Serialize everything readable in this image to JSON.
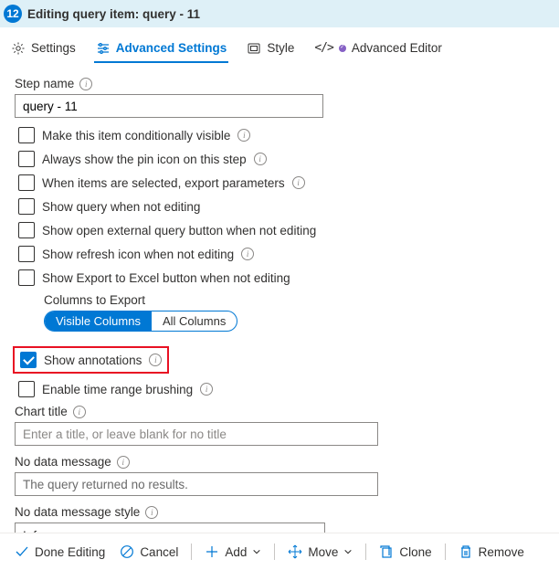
{
  "header": {
    "stepNumber": "12",
    "title": "Editing query item: query - 11"
  },
  "tabs": {
    "settings": "Settings",
    "advanced": "Advanced Settings",
    "style": "Style",
    "advancedEditor": "Advanced Editor"
  },
  "fields": {
    "stepNameLabel": "Step name",
    "stepNameValue": "query - 11",
    "cb_conditional": "Make this item conditionally visible",
    "cb_pin": "Always show the pin icon on this step",
    "cb_export": "When items are selected, export parameters",
    "cb_showQuery": "Show query when not editing",
    "cb_external": "Show open external query button when not editing",
    "cb_refresh": "Show refresh icon when not editing",
    "cb_excel": "Show Export to Excel button when not editing",
    "columnsLabel": "Columns to Export",
    "pill_visible": "Visible Columns",
    "pill_all": "All Columns",
    "cb_annotations": "Show annotations",
    "cb_brushing": "Enable time range brushing",
    "chartTitleLabel": "Chart title",
    "chartTitlePlaceholder": "Enter a title, or leave blank for no title",
    "noDataLabel": "No data message",
    "noDataValue": "The query returned no results.",
    "noDataStyleLabel": "No data message style",
    "noDataStyleValue": "Info"
  },
  "footer": {
    "done": "Done Editing",
    "cancel": "Cancel",
    "add": "Add",
    "move": "Move",
    "clone": "Clone",
    "remove": "Remove"
  }
}
